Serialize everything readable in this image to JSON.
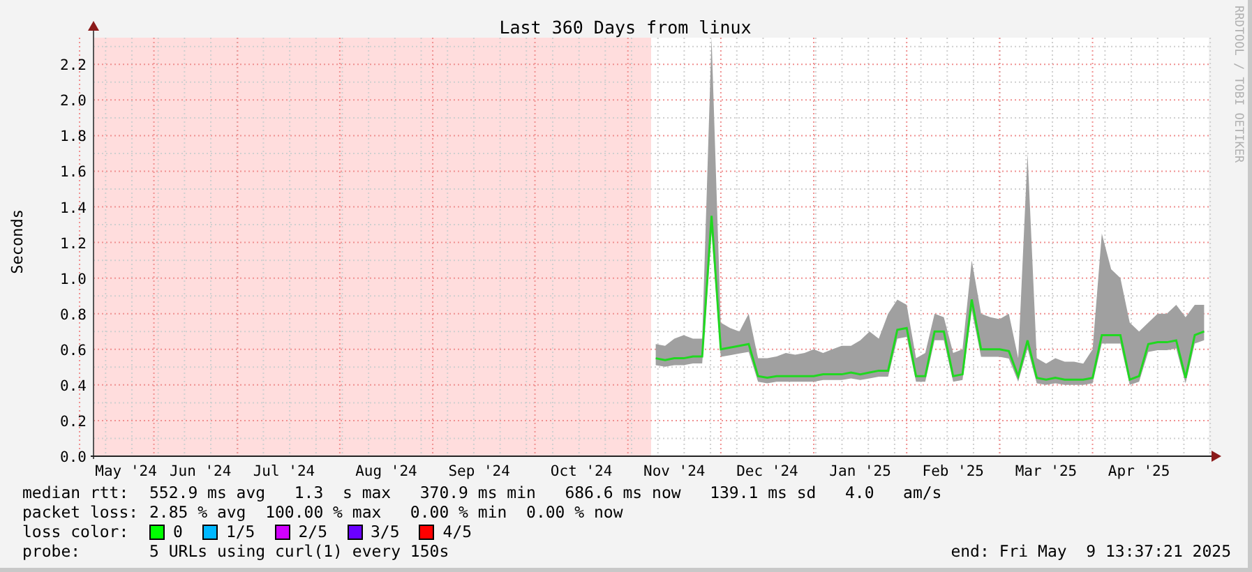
{
  "chart": {
    "chart_data": {
      "type": "line",
      "grid": true,
      "title": "Last 360 Days from linux",
      "ylabel": "Seconds",
      "ylim": [
        0,
        2.35
      ],
      "yticks": [
        {
          "value": 0,
          "label": "0.0"
        },
        {
          "value": 0.2,
          "label": "0.2"
        },
        {
          "value": 0.4,
          "label": "0.4"
        },
        {
          "value": 0.6,
          "label": "0.6"
        },
        {
          "value": 0.8,
          "label": "0.8"
        },
        {
          "value": 1,
          "label": "1.0"
        },
        {
          "value": 1.2,
          "label": "1.2"
        },
        {
          "value": 1.4,
          "label": "1.4"
        },
        {
          "value": 1.6,
          "label": "1.6"
        },
        {
          "value": 1.8,
          "label": "1.8"
        },
        {
          "value": 2,
          "label": "2.0"
        },
        {
          "value": 2.2,
          "label": "2.2"
        }
      ],
      "categories": [
        null,
        null,
        null,
        "May '24",
        null,
        null,
        null,
        null,
        null,
        null,
        null,
        "Jun '24",
        null,
        null,
        null,
        null,
        null,
        null,
        null,
        null,
        "Jul '24",
        null,
        null,
        null,
        null,
        null,
        null,
        null,
        null,
        null,
        null,
        "Aug '24",
        null,
        null,
        null,
        null,
        null,
        null,
        null,
        null,
        null,
        "Sep '24",
        null,
        null,
        null,
        null,
        null,
        null,
        null,
        null,
        null,
        null,
        "Oct '24",
        null,
        null,
        null,
        null,
        null,
        null,
        null,
        null,
        null,
        "Nov '24",
        null,
        null,
        null,
        null,
        null,
        null,
        null,
        null,
        null,
        "Dec '24",
        null,
        null,
        null,
        null,
        null,
        null,
        null,
        null,
        null,
        "Jan '25",
        null,
        null,
        null,
        null,
        null,
        null,
        null,
        null,
        null,
        "Feb '25",
        null,
        null,
        null,
        null,
        null,
        null,
        null,
        null,
        null,
        "Mar '25",
        null,
        null,
        null,
        null,
        null,
        null,
        null,
        null,
        null,
        "Apr '25",
        null,
        null,
        null,
        null,
        null,
        null,
        null
      ],
      "series": [
        {
          "type": "area",
          "color": "#a0a0a0",
          "values": [
            null,
            null,
            null,
            null,
            null,
            null,
            null,
            null,
            null,
            null,
            null,
            null,
            null,
            null,
            null,
            null,
            null,
            null,
            null,
            null,
            null,
            null,
            null,
            null,
            null,
            null,
            null,
            null,
            null,
            null,
            null,
            null,
            null,
            null,
            null,
            null,
            null,
            null,
            null,
            null,
            null,
            null,
            null,
            null,
            null,
            null,
            null,
            null,
            null,
            null,
            null,
            null,
            null,
            null,
            null,
            null,
            null,
            null,
            null,
            null,
            0.63,
            0.62,
            0.66,
            0.68,
            0.66,
            0.66,
            2.35,
            0.75,
            0.72,
            0.7,
            0.8,
            0.55,
            0.55,
            0.56,
            0.58,
            0.57,
            0.58,
            0.6,
            0.58,
            0.6,
            0.62,
            0.62,
            0.65,
            0.7,
            0.66,
            0.8,
            0.88,
            0.85,
            0.55,
            0.58,
            0.8,
            0.78,
            0.58,
            0.6,
            1.1,
            0.8,
            0.78,
            0.77,
            0.8,
            0.55,
            1.7,
            0.55,
            0.52,
            0.55,
            0.53,
            0.53,
            0.52,
            0.6,
            1.25,
            1.05,
            1.0,
            0.75,
            0.7,
            0.75,
            0.8,
            0.8,
            0.85,
            0.78,
            0.85,
            0.85
          ]
        },
        {
          "type": "line",
          "color": "#20d820",
          "values": [
            null,
            null,
            null,
            null,
            null,
            null,
            null,
            null,
            null,
            null,
            null,
            null,
            null,
            null,
            null,
            null,
            null,
            null,
            null,
            null,
            null,
            null,
            null,
            null,
            null,
            null,
            null,
            null,
            null,
            null,
            null,
            null,
            null,
            null,
            null,
            null,
            null,
            null,
            null,
            null,
            null,
            null,
            null,
            null,
            null,
            null,
            null,
            null,
            null,
            null,
            null,
            null,
            null,
            null,
            null,
            null,
            null,
            null,
            null,
            null,
            0.55,
            0.54,
            0.55,
            0.55,
            0.56,
            0.56,
            1.35,
            0.6,
            0.61,
            0.62,
            0.63,
            0.45,
            0.44,
            0.45,
            0.45,
            0.45,
            0.45,
            0.45,
            0.46,
            0.46,
            0.46,
            0.47,
            0.46,
            0.47,
            0.48,
            0.48,
            0.71,
            0.72,
            0.45,
            0.45,
            0.7,
            0.7,
            0.45,
            0.46,
            0.88,
            0.6,
            0.6,
            0.6,
            0.59,
            0.45,
            0.65,
            0.44,
            0.43,
            0.44,
            0.43,
            0.43,
            0.43,
            0.44,
            0.68,
            0.68,
            0.68,
            0.43,
            0.45,
            0.63,
            0.64,
            0.64,
            0.65,
            0.44,
            0.68,
            0.7
          ]
        }
      ]
    }
  },
  "credit": "RRDTOOL / TOBI OETIKER",
  "legend": {
    "rows": [
      {
        "kind": "text",
        "label": "median rtt:",
        "value": "552.9 ms avg   1.3  s max   370.9 ms min   686.6 ms now   139.1 ms sd   4.0   am/s"
      },
      {
        "kind": "text",
        "label": "packet loss:",
        "value": "2.85 % avg  100.00 % max   0.00 % min  0.00 % now"
      },
      {
        "kind": "swatches",
        "label": "loss color:",
        "items": [
          {
            "label": "0",
            "color": "#00ff00"
          },
          {
            "label": "1/5",
            "color": "#00b8ff"
          },
          {
            "label": "2/5",
            "color": "#d000ff"
          },
          {
            "label": "3/5",
            "color": "#6a00ff"
          },
          {
            "label": "4/5",
            "color": "#ff0000"
          }
        ]
      },
      {
        "kind": "text",
        "label": "probe:",
        "value": "5 URLs using curl(1) every 150s",
        "end": "end: Fri May  9 13:37:21 2025"
      }
    ]
  }
}
